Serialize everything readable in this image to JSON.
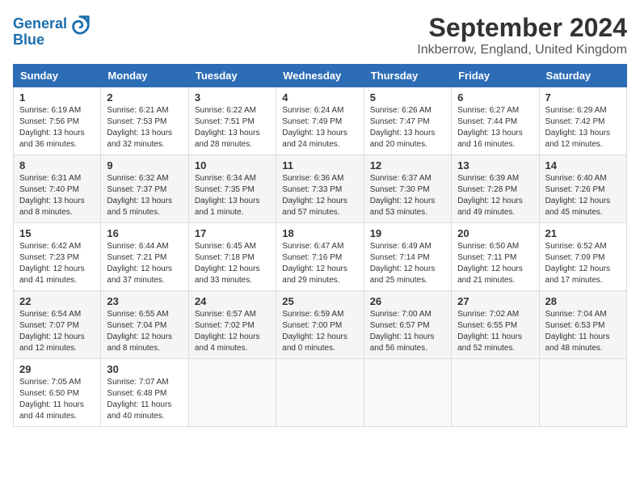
{
  "logo": {
    "line1": "General",
    "line2": "Blue"
  },
  "title": "September 2024",
  "subtitle": "Inkberrow, England, United Kingdom",
  "days_header": [
    "Sunday",
    "Monday",
    "Tuesday",
    "Wednesday",
    "Thursday",
    "Friday",
    "Saturday"
  ],
  "weeks": [
    [
      {
        "day": "1",
        "info": "Sunrise: 6:19 AM\nSunset: 7:56 PM\nDaylight: 13 hours\nand 36 minutes."
      },
      {
        "day": "2",
        "info": "Sunrise: 6:21 AM\nSunset: 7:53 PM\nDaylight: 13 hours\nand 32 minutes."
      },
      {
        "day": "3",
        "info": "Sunrise: 6:22 AM\nSunset: 7:51 PM\nDaylight: 13 hours\nand 28 minutes."
      },
      {
        "day": "4",
        "info": "Sunrise: 6:24 AM\nSunset: 7:49 PM\nDaylight: 13 hours\nand 24 minutes."
      },
      {
        "day": "5",
        "info": "Sunrise: 6:26 AM\nSunset: 7:47 PM\nDaylight: 13 hours\nand 20 minutes."
      },
      {
        "day": "6",
        "info": "Sunrise: 6:27 AM\nSunset: 7:44 PM\nDaylight: 13 hours\nand 16 minutes."
      },
      {
        "day": "7",
        "info": "Sunrise: 6:29 AM\nSunset: 7:42 PM\nDaylight: 13 hours\nand 12 minutes."
      }
    ],
    [
      {
        "day": "8",
        "info": "Sunrise: 6:31 AM\nSunset: 7:40 PM\nDaylight: 13 hours\nand 8 minutes."
      },
      {
        "day": "9",
        "info": "Sunrise: 6:32 AM\nSunset: 7:37 PM\nDaylight: 13 hours\nand 5 minutes."
      },
      {
        "day": "10",
        "info": "Sunrise: 6:34 AM\nSunset: 7:35 PM\nDaylight: 13 hours\nand 1 minute."
      },
      {
        "day": "11",
        "info": "Sunrise: 6:36 AM\nSunset: 7:33 PM\nDaylight: 12 hours\nand 57 minutes."
      },
      {
        "day": "12",
        "info": "Sunrise: 6:37 AM\nSunset: 7:30 PM\nDaylight: 12 hours\nand 53 minutes."
      },
      {
        "day": "13",
        "info": "Sunrise: 6:39 AM\nSunset: 7:28 PM\nDaylight: 12 hours\nand 49 minutes."
      },
      {
        "day": "14",
        "info": "Sunrise: 6:40 AM\nSunset: 7:26 PM\nDaylight: 12 hours\nand 45 minutes."
      }
    ],
    [
      {
        "day": "15",
        "info": "Sunrise: 6:42 AM\nSunset: 7:23 PM\nDaylight: 12 hours\nand 41 minutes."
      },
      {
        "day": "16",
        "info": "Sunrise: 6:44 AM\nSunset: 7:21 PM\nDaylight: 12 hours\nand 37 minutes."
      },
      {
        "day": "17",
        "info": "Sunrise: 6:45 AM\nSunset: 7:18 PM\nDaylight: 12 hours\nand 33 minutes."
      },
      {
        "day": "18",
        "info": "Sunrise: 6:47 AM\nSunset: 7:16 PM\nDaylight: 12 hours\nand 29 minutes."
      },
      {
        "day": "19",
        "info": "Sunrise: 6:49 AM\nSunset: 7:14 PM\nDaylight: 12 hours\nand 25 minutes."
      },
      {
        "day": "20",
        "info": "Sunrise: 6:50 AM\nSunset: 7:11 PM\nDaylight: 12 hours\nand 21 minutes."
      },
      {
        "day": "21",
        "info": "Sunrise: 6:52 AM\nSunset: 7:09 PM\nDaylight: 12 hours\nand 17 minutes."
      }
    ],
    [
      {
        "day": "22",
        "info": "Sunrise: 6:54 AM\nSunset: 7:07 PM\nDaylight: 12 hours\nand 12 minutes."
      },
      {
        "day": "23",
        "info": "Sunrise: 6:55 AM\nSunset: 7:04 PM\nDaylight: 12 hours\nand 8 minutes."
      },
      {
        "day": "24",
        "info": "Sunrise: 6:57 AM\nSunset: 7:02 PM\nDaylight: 12 hours\nand 4 minutes."
      },
      {
        "day": "25",
        "info": "Sunrise: 6:59 AM\nSunset: 7:00 PM\nDaylight: 12 hours\nand 0 minutes."
      },
      {
        "day": "26",
        "info": "Sunrise: 7:00 AM\nSunset: 6:57 PM\nDaylight: 11 hours\nand 56 minutes."
      },
      {
        "day": "27",
        "info": "Sunrise: 7:02 AM\nSunset: 6:55 PM\nDaylight: 11 hours\nand 52 minutes."
      },
      {
        "day": "28",
        "info": "Sunrise: 7:04 AM\nSunset: 6:53 PM\nDaylight: 11 hours\nand 48 minutes."
      }
    ],
    [
      {
        "day": "29",
        "info": "Sunrise: 7:05 AM\nSunset: 6:50 PM\nDaylight: 11 hours\nand 44 minutes."
      },
      {
        "day": "30",
        "info": "Sunrise: 7:07 AM\nSunset: 6:48 PM\nDaylight: 11 hours\nand 40 minutes."
      },
      {
        "day": "",
        "info": ""
      },
      {
        "day": "",
        "info": ""
      },
      {
        "day": "",
        "info": ""
      },
      {
        "day": "",
        "info": ""
      },
      {
        "day": "",
        "info": ""
      }
    ]
  ]
}
